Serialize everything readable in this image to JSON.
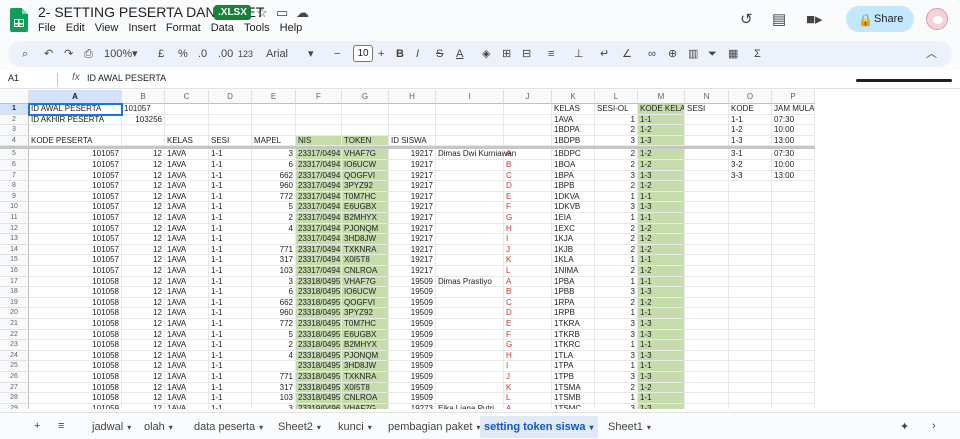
{
  "doc": {
    "title": "2- SETTING PESERTA DAN PAKET",
    "badge": ".XLSX"
  },
  "menu": [
    "File",
    "Edit",
    "View",
    "Insert",
    "Format",
    "Data",
    "Tools",
    "Help"
  ],
  "share_label": "Share",
  "toolbar": {
    "zoom": "100%",
    "currency": "£",
    "percent": "%",
    "dec_down": ".0",
    "dec_up": ".00",
    "num_fmt": "123",
    "font": "Arial",
    "font_size": "10"
  },
  "formula": {
    "cell_ref": "A1",
    "fx": "fx",
    "value": "ID AWAL PESERTA"
  },
  "columns": [
    "A",
    "B",
    "C",
    "D",
    "E",
    "F",
    "G",
    "H",
    "I",
    "J",
    "K",
    "L",
    "M",
    "N",
    "O",
    "P"
  ],
  "rows": [
    [
      "ID AWAL PESERTA",
      "101057",
      "",
      "",
      "",
      "",
      "",
      "",
      "",
      "",
      "KELAS",
      "SESI-OL",
      "KODE KELAS",
      "SESI",
      "KODE",
      "JAM MULAI"
    ],
    [
      "ID AKHIR PESERTA",
      "103256",
      "",
      "",
      "",
      "",
      "",
      "",
      "",
      "",
      "1AVA",
      "1",
      "1-1",
      "",
      "1-1",
      "07:30"
    ],
    [
      "",
      "",
      "",
      "",
      "",
      "",
      "",
      "",
      "",
      "",
      "1BDPA",
      "2",
      "1-2",
      "",
      "1-2",
      "10:00"
    ],
    [
      "KODE PESERTA",
      "",
      "KELAS",
      "SESI",
      "MAPEL",
      "NIS",
      "TOKEN",
      "ID SISWA",
      "",
      "",
      "1BDPB",
      "3",
      "1-3",
      "",
      "1-3",
      "13:00"
    ],
    [
      "101057",
      "12",
      "1AVA",
      "1-1",
      "3",
      "23317/0494",
      "VHAF7G",
      "19217",
      "Dimas Dwi Kurniawan",
      "A",
      "1BDPC",
      "2",
      "1-2",
      "",
      "3-1",
      "07:30"
    ],
    [
      "101057",
      "12",
      "1AVA",
      "1-1",
      "6",
      "23317/0494",
      "IO6UCW",
      "19217",
      "",
      "B",
      "1BOA",
      "2",
      "1-2",
      "",
      "3-2",
      "10:00"
    ],
    [
      "101057",
      "12",
      "1AVA",
      "1-1",
      "662",
      "23317/0494",
      "QOGFVI",
      "19217",
      "",
      "C",
      "1BPA",
      "3",
      "1-3",
      "",
      "3-3",
      "13:00"
    ],
    [
      "101057",
      "12",
      "1AVA",
      "1-1",
      "960",
      "23317/0494",
      "3PYZ92",
      "19217",
      "",
      "D",
      "1BPB",
      "2",
      "1-2",
      "",
      "",
      ""
    ],
    [
      "101057",
      "12",
      "1AVA",
      "1-1",
      "772",
      "23317/0494",
      "T0M7HC",
      "19217",
      "",
      "E",
      "1DKVA",
      "1",
      "1-1",
      "",
      "",
      ""
    ],
    [
      "101057",
      "12",
      "1AVA",
      "1-1",
      "5",
      "23317/0494",
      "E6UGBX",
      "19217",
      "",
      "F",
      "1DKVB",
      "3",
      "1-3",
      "",
      "",
      ""
    ],
    [
      "101057",
      "12",
      "1AVA",
      "1-1",
      "2",
      "23317/0494",
      "B2MHYX",
      "19217",
      "",
      "G",
      "1EIA",
      "1",
      "1-1",
      "",
      "",
      ""
    ],
    [
      "101057",
      "12",
      "1AVA",
      "1-1",
      "4",
      "23317/0494",
      "PJONQM",
      "19217",
      "",
      "H",
      "1EXC",
      "2",
      "1-2",
      "",
      "",
      ""
    ],
    [
      "101057",
      "12",
      "1AVA",
      "1-1",
      "",
      "23317/0494",
      "3HD8JW",
      "19217",
      "",
      "I",
      "1KJA",
      "2",
      "1-2",
      "",
      "",
      ""
    ],
    [
      "101057",
      "12",
      "1AVA",
      "1-1",
      "771",
      "23317/0494",
      "TXKNRA",
      "19217",
      "",
      "J",
      "1KJB",
      "2",
      "1-2",
      "",
      "",
      ""
    ],
    [
      "101057",
      "12",
      "1AVA",
      "1-1",
      "317",
      "23317/0494",
      "X0I5T8",
      "19217",
      "",
      "K",
      "1KLA",
      "1",
      "1-1",
      "",
      "",
      ""
    ],
    [
      "101057",
      "12",
      "1AVA",
      "1-1",
      "103",
      "23317/0494",
      "CNLROA",
      "19217",
      "",
      "L",
      "1NIMA",
      "2",
      "1-2",
      "",
      "",
      ""
    ],
    [
      "101058",
      "12",
      "1AVA",
      "1-1",
      "3",
      "23318/0495",
      "VHAF7G",
      "19509",
      "Dimas Prastiyo",
      "A",
      "1PBA",
      "1",
      "1-1",
      "",
      "",
      ""
    ],
    [
      "101058",
      "12",
      "1AVA",
      "1-1",
      "6",
      "23318/0495",
      "IO6UCW",
      "19509",
      "",
      "B",
      "1PBB",
      "3",
      "1-3",
      "",
      "",
      ""
    ],
    [
      "101058",
      "12",
      "1AVA",
      "1-1",
      "662",
      "23318/0495",
      "QOGFVI",
      "19509",
      "",
      "C",
      "1RPA",
      "2",
      "1-2",
      "",
      "",
      ""
    ],
    [
      "101058",
      "12",
      "1AVA",
      "1-1",
      "960",
      "23318/0495",
      "3PYZ92",
      "19509",
      "",
      "D",
      "1RPB",
      "1",
      "1-1",
      "",
      "",
      ""
    ],
    [
      "101058",
      "12",
      "1AVA",
      "1-1",
      "772",
      "23318/0495",
      "T0M7HC",
      "19509",
      "",
      "E",
      "1TKRA",
      "3",
      "1-3",
      "",
      "",
      ""
    ],
    [
      "101058",
      "12",
      "1AVA",
      "1-1",
      "5",
      "23318/0495",
      "E6UGBX",
      "19509",
      "",
      "F",
      "1TKRB",
      "3",
      "1-3",
      "",
      "",
      ""
    ],
    [
      "101058",
      "12",
      "1AVA",
      "1-1",
      "2",
      "23318/0495",
      "B2MHYX",
      "19509",
      "",
      "G",
      "1TKRC",
      "1",
      "1-1",
      "",
      "",
      ""
    ],
    [
      "101058",
      "12",
      "1AVA",
      "1-1",
      "4",
      "23318/0495",
      "PJONQM",
      "19509",
      "",
      "H",
      "1TLA",
      "3",
      "1-3",
      "",
      "",
      ""
    ],
    [
      "101058",
      "12",
      "1AVA",
      "1-1",
      "",
      "23318/0495",
      "3HD8JW",
      "19509",
      "",
      "I",
      "1TPA",
      "1",
      "1-1",
      "",
      "",
      ""
    ],
    [
      "101058",
      "12",
      "1AVA",
      "1-1",
      "771",
      "23318/0495",
      "TXKNRA",
      "19509",
      "",
      "J",
      "1TPB",
      "3",
      "1-3",
      "",
      "",
      ""
    ],
    [
      "101058",
      "12",
      "1AVA",
      "1-1",
      "317",
      "23318/0495",
      "X0I5T8",
      "19509",
      "",
      "K",
      "1TSMA",
      "2",
      "1-2",
      "",
      "",
      ""
    ],
    [
      "101058",
      "12",
      "1AVA",
      "1-1",
      "103",
      "23318/0495",
      "CNLROA",
      "19509",
      "",
      "L",
      "1TSMB",
      "1",
      "1-1",
      "",
      "",
      ""
    ],
    [
      "101059",
      "12",
      "1AVA",
      "1-1",
      "3",
      "23319/0496",
      "VHAF7G",
      "19273",
      "Eika Liana Putri",
      "A",
      "1TSMC",
      "3",
      "1-3",
      "",
      "",
      ""
    ]
  ],
  "sheets": [
    "jadwal",
    "olah",
    "data peserta",
    "Sheet2",
    "kunci",
    "pembagian paket",
    "setting token siswa",
    "Sheet1"
  ],
  "active_sheet": "setting token siswa"
}
